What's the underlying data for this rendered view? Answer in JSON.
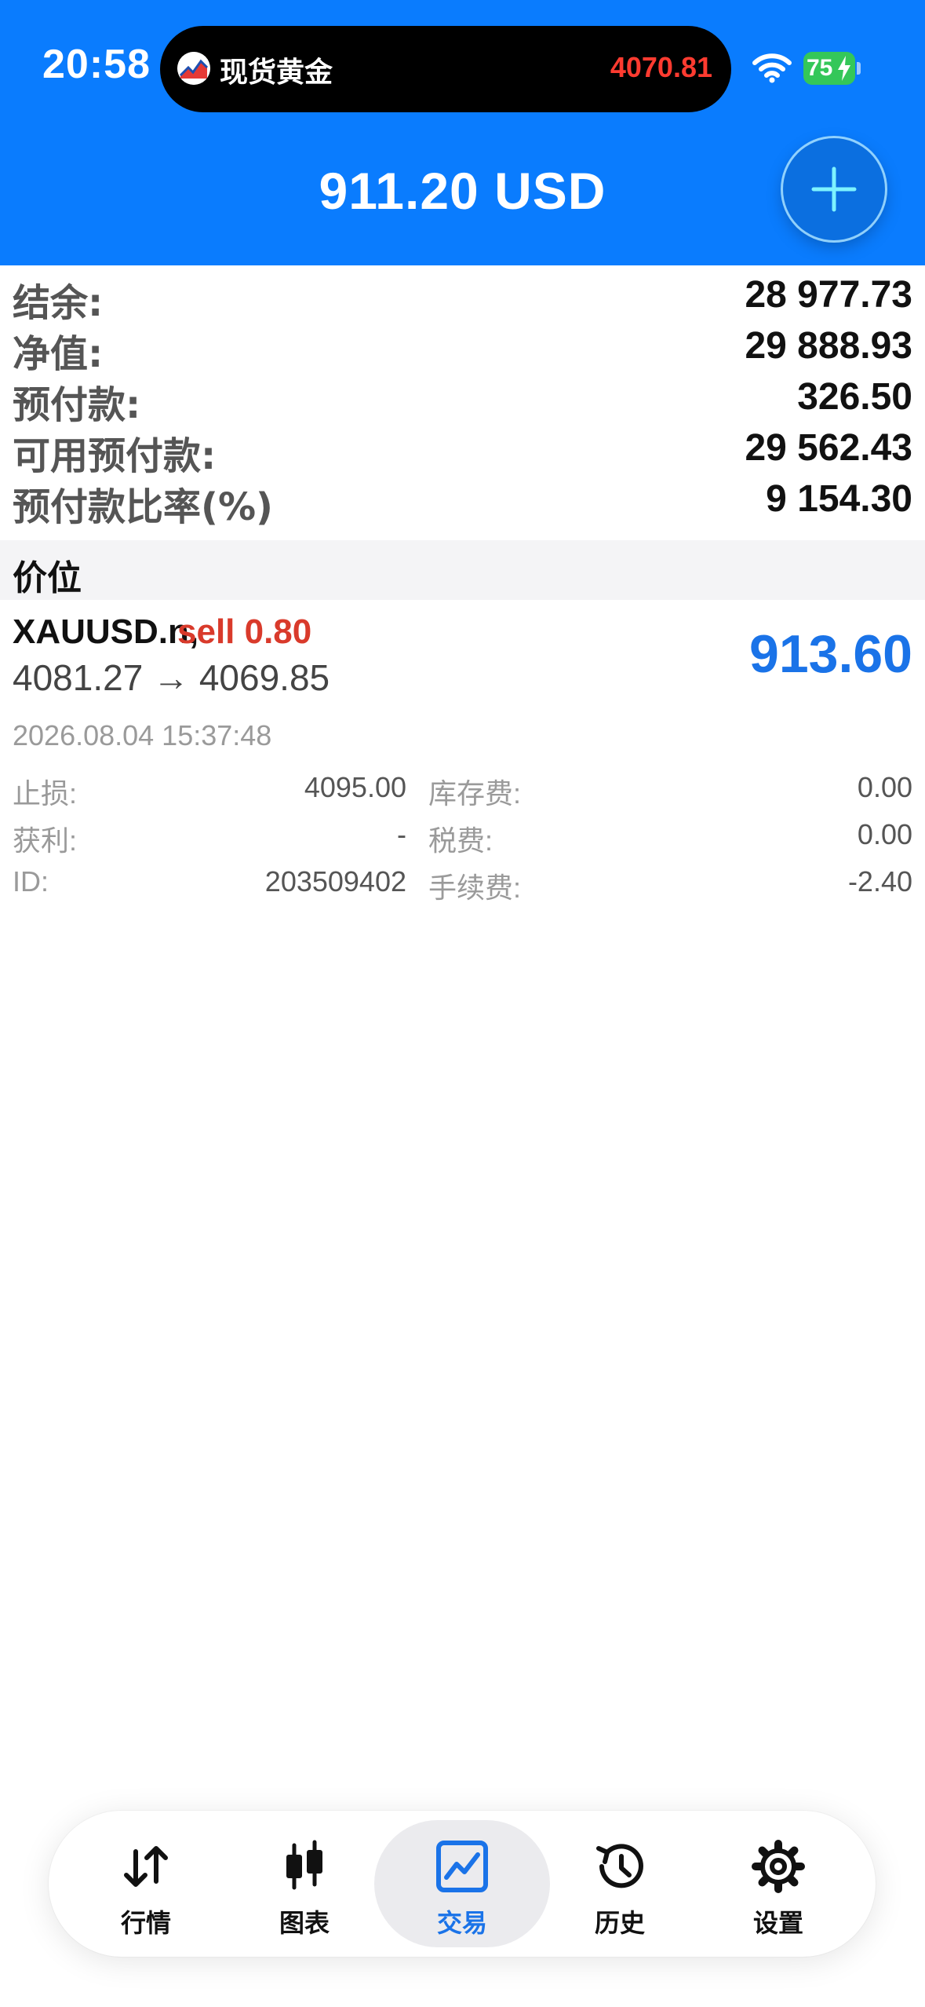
{
  "status_bar": {
    "time": "20:58",
    "battery": "75",
    "island_title": "现货黄金",
    "island_price": "4070.81"
  },
  "header": {
    "profit_total": "911.20 USD"
  },
  "account": {
    "rows": [
      {
        "label": "结余:",
        "value": "28 977.73"
      },
      {
        "label": "净值:",
        "value": "29 888.93"
      },
      {
        "label": "预付款:",
        "value": "326.50"
      },
      {
        "label": "可用预付款:",
        "value": "29 562.43"
      },
      {
        "label": "预付款比率(%)",
        "value": "9 154.30"
      }
    ]
  },
  "section": {
    "title": "价位"
  },
  "position": {
    "symbol": "XAUUSD.n,",
    "side": "sell 0.80",
    "prices": "4081.27 → 4069.85",
    "profit": "913.60",
    "open_time": "2026.08.04 15:37:48",
    "details": {
      "stop_loss_label": "止损:",
      "stop_loss_value": "4095.00",
      "take_profit_label": "获利:",
      "take_profit_value": "-",
      "id_label": "ID:",
      "id_value": "203509402",
      "swap_label": "库存费:",
      "swap_value": "0.00",
      "tax_label": "税费:",
      "tax_value": "0.00",
      "commission_label": "手续费:",
      "commission_value": "-2.40"
    }
  },
  "tabs": [
    {
      "label": "行情",
      "icon": "quotes-arrows-icon",
      "active": false
    },
    {
      "label": "图表",
      "icon": "candlestick-chart-icon",
      "active": false
    },
    {
      "label": "交易",
      "icon": "trade-chart-icon",
      "active": true
    },
    {
      "label": "历史",
      "icon": "history-clock-icon",
      "active": false
    },
    {
      "label": "设置",
      "icon": "gear-icon",
      "active": false
    }
  ],
  "colors": {
    "header_blue": "#0a7cfe",
    "profit_blue": "#1a73e8",
    "sell_red": "#d93a2b",
    "island_price_red": "#ff3b30",
    "battery_green": "#34c759"
  }
}
